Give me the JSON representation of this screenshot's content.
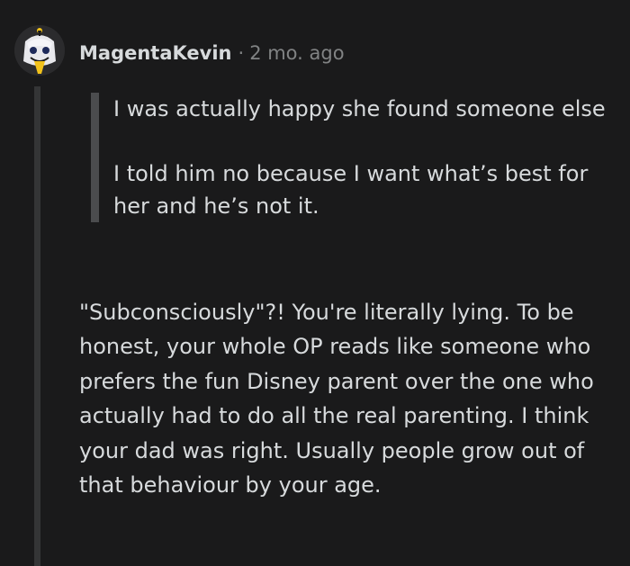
{
  "comment": {
    "author": "MagentaKevin",
    "separator": "·",
    "age": "2 mo. ago",
    "quote": [
      "I was actually happy she found someone else",
      "I told him no because I want what’s best for her and he’s not it."
    ],
    "body": "\"Subconsciously\"?! You're literally lying. To be honest, your whole OP reads like someone who prefers the fun Disney parent over the one who actually had to do all the real parenting. I think your dad was right. Usually people grow out of that behaviour by your age."
  },
  "colors": {
    "background": "#1a1a1b",
    "text": "#d7dadc",
    "meta": "#818384",
    "quote_bar": "#4b4c4e",
    "thread_line": "#343536"
  }
}
